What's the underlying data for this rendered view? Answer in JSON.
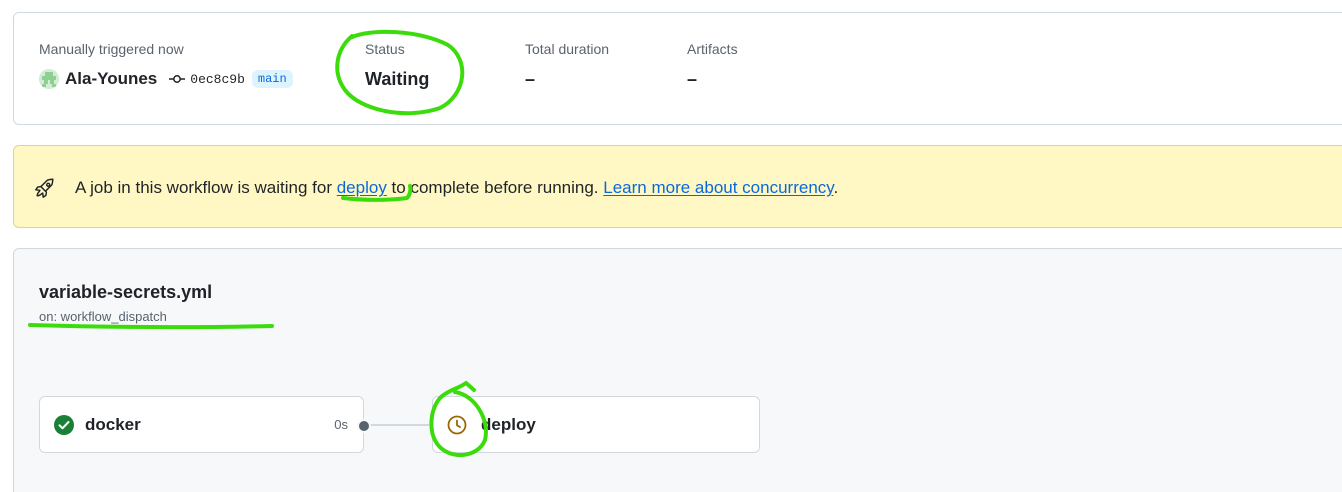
{
  "summary": {
    "trigger_label": "Manually triggered now",
    "actor": "Ala-Younes",
    "commit_sha": "0ec8c9b",
    "branch": "main",
    "status_label": "Status",
    "status_value": "Waiting",
    "duration_label": "Total duration",
    "duration_value": "–",
    "artifacts_label": "Artifacts",
    "artifacts_value": "–"
  },
  "banner": {
    "text_before": "A job in this workflow is waiting for ",
    "job_link": "deploy",
    "text_middle": " to complete before running. ",
    "learn_link": "Learn more about concurrency",
    "text_after": "."
  },
  "workflow": {
    "file_name": "variable-secrets.yml",
    "trigger": "on: workflow_dispatch",
    "jobs": [
      {
        "name": "docker",
        "status": "success",
        "duration": "0s"
      },
      {
        "name": "deploy",
        "status": "waiting",
        "duration": ""
      }
    ]
  },
  "icons": {
    "avatar": "avatar-identicon",
    "commit": "git-commit-icon",
    "banner": "rocket-icon",
    "docker_status": "check-circle-icon",
    "deploy_status": "clock-icon"
  },
  "colors": {
    "success": "#1a7f37",
    "waiting": "#9a6700",
    "link": "#0969da",
    "banner_bg": "#fff8c5",
    "annotation": "#3cdc0c"
  }
}
